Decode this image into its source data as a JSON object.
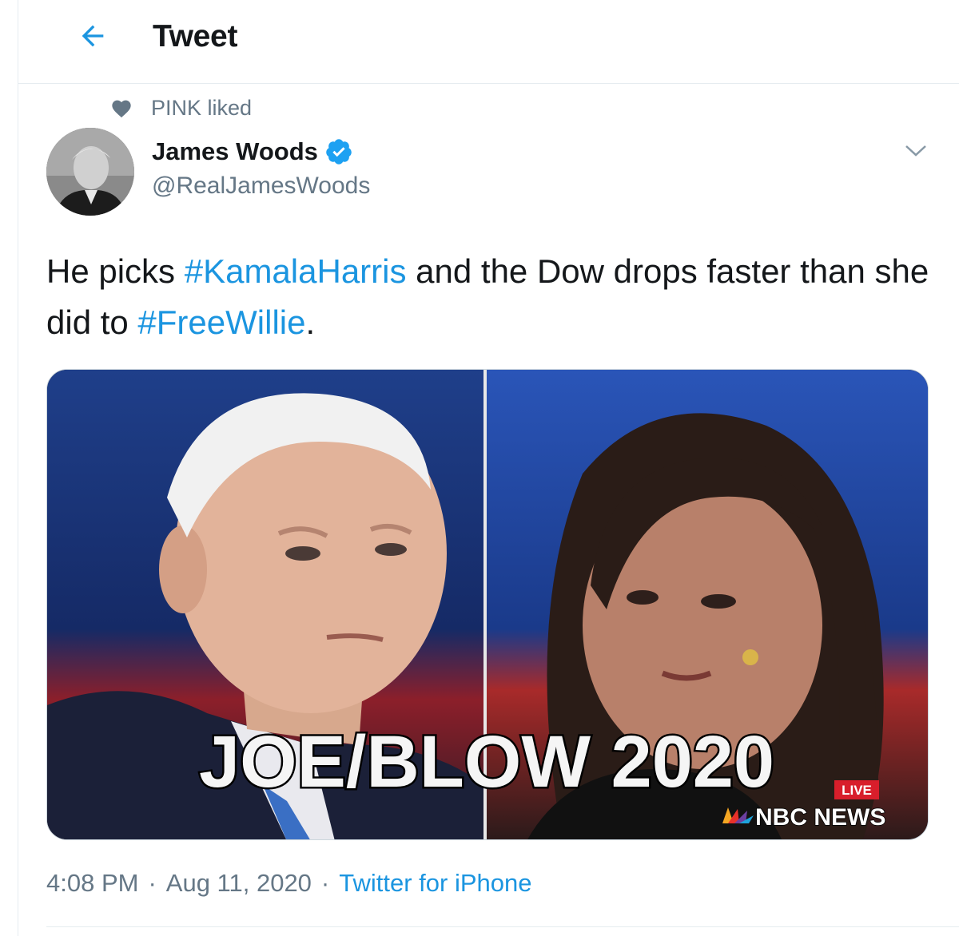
{
  "header": {
    "back_icon": "arrow-left-icon",
    "title": "Tweet"
  },
  "social_context": {
    "icon": "heart-icon",
    "text": "PINK liked"
  },
  "author": {
    "name": "James Woods",
    "handle": "@RealJamesWoods",
    "verified_icon": "verified-badge-icon"
  },
  "tweet": {
    "text_before": "He picks ",
    "hashtag_1": "#KamalaHarris",
    "text_middle": " and the Dow drops faster than she did to ",
    "hashtag_2": "#FreeWillie",
    "text_after": "."
  },
  "media": {
    "caption": "JOE/BLOW 2020",
    "live_badge": "LIVE",
    "network": "NBC NEWS"
  },
  "meta": {
    "time": "4:08 PM",
    "separator": "·",
    "date": "Aug 11, 2020",
    "source": "Twitter for iPhone"
  },
  "colors": {
    "link": "#1b95e0",
    "secondary_text": "#657786",
    "primary_text": "#14171a",
    "border": "#e6ecf0",
    "verified": "#1da1f2"
  }
}
